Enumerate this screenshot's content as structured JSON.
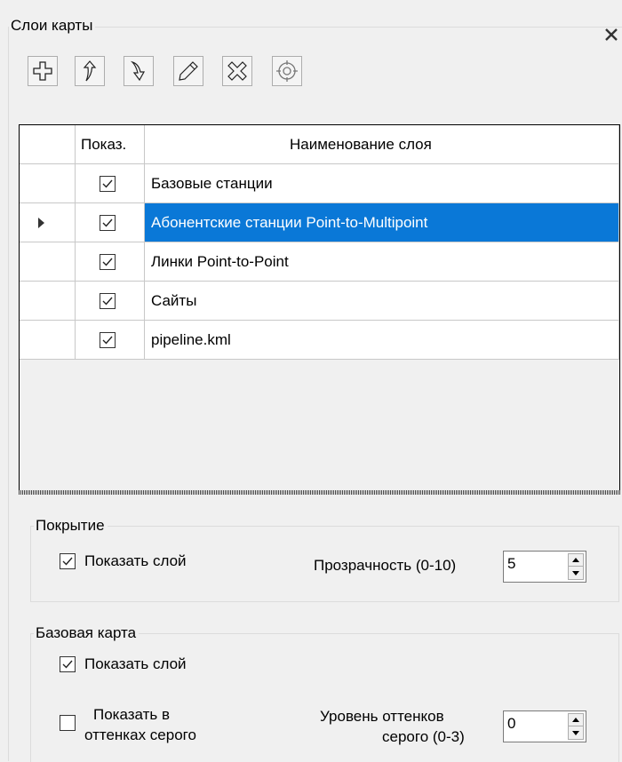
{
  "panel": {
    "title": "Слои карты",
    "close_icon": "close-icon"
  },
  "toolbar": {
    "buttons": [
      {
        "icon": "add-icon",
        "label": "Add layer"
      },
      {
        "icon": "move-up-icon",
        "label": "Move up"
      },
      {
        "icon": "move-down-icon",
        "label": "Move down"
      },
      {
        "icon": "edit-pencil-icon",
        "label": "Edit"
      },
      {
        "icon": "delete-icon",
        "label": "Delete"
      },
      {
        "icon": "target-icon",
        "label": "Zoom to layer"
      }
    ]
  },
  "grid": {
    "columns": [
      "Показ.",
      "Наименование слоя"
    ],
    "rows": [
      {
        "show": true,
        "name": "Базовые станции",
        "selected": false
      },
      {
        "show": true,
        "name": "Абонентские станции Point-to-Multipoint",
        "selected": true
      },
      {
        "show": true,
        "name": "Линки Point-to-Point",
        "selected": false
      },
      {
        "show": true,
        "name": "Сайты",
        "selected": false
      },
      {
        "show": true,
        "name": "pipeline.kml",
        "selected": false
      }
    ],
    "selection_color": "#0a78d7"
  },
  "coverage": {
    "title": "Покрытие",
    "show_layer_label": "Показать слой",
    "show_layer_checked": true,
    "transparency_label": "Прозрачность (0-10)",
    "transparency_value": "5"
  },
  "basemap": {
    "title": "Базовая карта",
    "show_layer_label": "Показать слой",
    "show_layer_checked": true,
    "grayscale_label_line1": "Показать в",
    "grayscale_label_line2": "оттенках серого",
    "grayscale_checked": false,
    "gray_level_label_line1": "Уровень оттенков",
    "gray_level_label_line2": "серого (0-3)",
    "gray_level_value": "0"
  }
}
